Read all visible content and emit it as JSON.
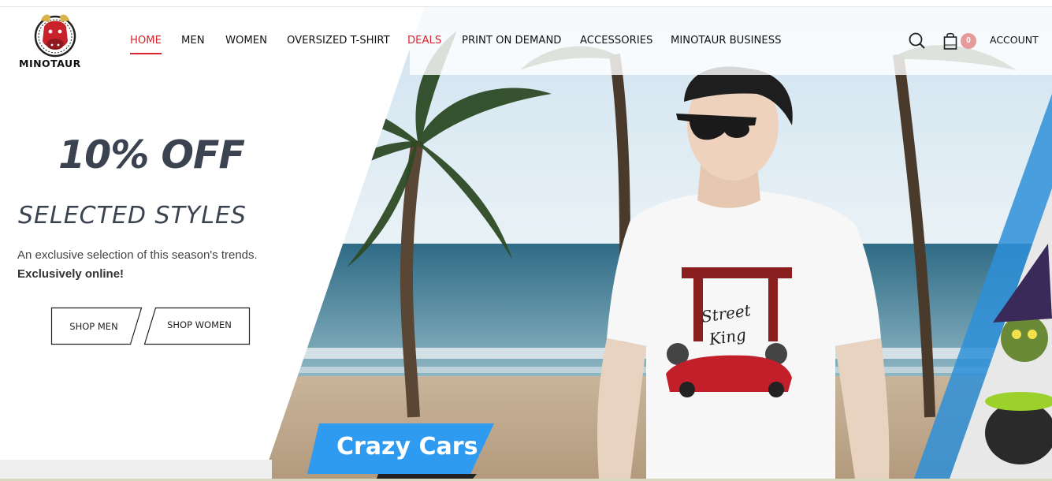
{
  "brand": {
    "name": "MINOTAUR"
  },
  "nav": {
    "items": [
      {
        "label": "HOME",
        "state": "active"
      },
      {
        "label": "MEN"
      },
      {
        "label": "WOMEN"
      },
      {
        "label": "OVERSIZED T-SHIRT"
      },
      {
        "label": "DEALS",
        "state": "highlighted"
      },
      {
        "label": "PRINT ON DEMAND"
      },
      {
        "label": "ACCESSORIES"
      },
      {
        "label": "MINOTAUR BUSINESS"
      }
    ]
  },
  "header_icons": {
    "search": "search-icon",
    "cart": "shopping-bag-icon",
    "cart_count": "0",
    "account_label": "ACCOUNT"
  },
  "promo": {
    "title": "10% OFF",
    "subtitle": "SELECTED STYLES",
    "description": "An exclusive selection of this season's trends.",
    "description_bold": "Exclusively online!",
    "buttons": {
      "men": "SHOP MEN",
      "women": "SHOP WOMEN"
    }
  },
  "banner": {
    "tag": "Crazy Cars",
    "shirt_print": "Street King"
  },
  "colors": {
    "accent_red": "#d9232d",
    "text_dark": "#3b4350",
    "tag_blue": "#2e9bf0",
    "badge": "#e69a9a"
  }
}
